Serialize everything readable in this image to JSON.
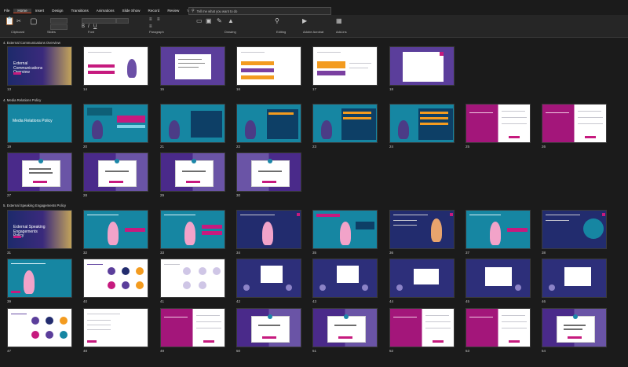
{
  "ribbon": {
    "tabs": [
      "File",
      "Home",
      "Insert",
      "Design",
      "Transitions",
      "Animations",
      "Slide Show",
      "Record",
      "Review",
      "View",
      "Developer",
      "Help"
    ],
    "active_tab": "Home",
    "search_placeholder": "Tell me what you want to do",
    "groups": [
      "Clipboard",
      "Slides",
      "Font",
      "Paragraph",
      "Drawing",
      "Editing",
      "Adobe Acrobat",
      "Add-ins"
    ]
  },
  "sections": [
    {
      "title": "4. External Communications Overview",
      "first_slide": 13
    },
    {
      "title": "4. Media Relations Policy",
      "first_slide": 19
    },
    {
      "title": "5. External Speaking Engagements Policy",
      "first_slide": 31
    }
  ],
  "slides": {
    "row1": [
      {
        "num": "13",
        "title": "External Communications Overview"
      },
      {
        "num": "14"
      },
      {
        "num": "15"
      },
      {
        "num": "16"
      },
      {
        "num": "17"
      },
      {
        "num": "18"
      }
    ],
    "row2": [
      {
        "num": "19",
        "title": "Media Relations Policy"
      },
      {
        "num": "20"
      },
      {
        "num": "21"
      },
      {
        "num": "22"
      },
      {
        "num": "23"
      },
      {
        "num": "24"
      },
      {
        "num": "25"
      },
      {
        "num": "26"
      }
    ],
    "row3": [
      {
        "num": "27"
      },
      {
        "num": "28"
      },
      {
        "num": "29"
      },
      {
        "num": "30"
      }
    ],
    "row4": [
      {
        "num": "31",
        "title": "External Speaking Engagements Policy"
      },
      {
        "num": "32"
      },
      {
        "num": "33"
      },
      {
        "num": "34"
      },
      {
        "num": "35"
      },
      {
        "num": "36"
      },
      {
        "num": "37"
      },
      {
        "num": "38"
      }
    ],
    "row5": [
      {
        "num": "39"
      },
      {
        "num": "40"
      },
      {
        "num": "41"
      },
      {
        "num": "42"
      },
      {
        "num": "43"
      },
      {
        "num": "44"
      },
      {
        "num": "45"
      },
      {
        "num": "46"
      }
    ],
    "row6": [
      {
        "num": "47"
      },
      {
        "num": "48"
      },
      {
        "num": "49"
      },
      {
        "num": "50"
      },
      {
        "num": "51"
      },
      {
        "num": "52"
      },
      {
        "num": "53"
      },
      {
        "num": "54"
      }
    ]
  },
  "colors": {
    "magenta": "#c61a7e",
    "teal": "#1686a2",
    "purple": "#5b3e9b",
    "navy": "#222c6e",
    "orange": "#f39b1f"
  }
}
